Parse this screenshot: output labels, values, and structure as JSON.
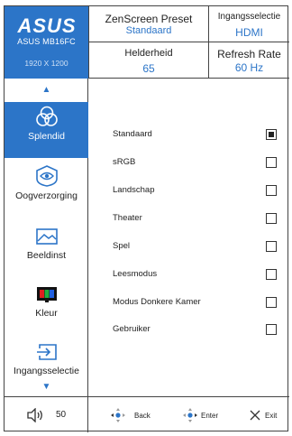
{
  "header": {
    "brand": "ASUS",
    "model": "ASUS MB16FC",
    "resolution": "1920 X 1200",
    "zenscreen_preset_label": "ZenScreen Preset",
    "zenscreen_preset_value": "Standaard",
    "input_label": "Ingangsselectie",
    "input_value": "HDMI",
    "brightness_label": "Helderheid",
    "brightness_value": "65",
    "refresh_label": "Refresh Rate",
    "refresh_value": "60 Hz"
  },
  "sidebar": {
    "items": [
      {
        "label": "Splendid",
        "icon": "splendid-icon",
        "active": true
      },
      {
        "label": "Oogverzorging",
        "icon": "eye-icon",
        "active": false
      },
      {
        "label": "Beeldinst",
        "icon": "image-icon",
        "active": false
      },
      {
        "label": "Kleur",
        "icon": "color-icon",
        "active": false
      },
      {
        "label": "Ingangsselectie",
        "icon": "input-icon",
        "active": false
      }
    ]
  },
  "options": [
    {
      "label": "Standaard",
      "selected": true
    },
    {
      "label": "sRGB",
      "selected": false
    },
    {
      "label": "Landschap",
      "selected": false
    },
    {
      "label": "Theater",
      "selected": false
    },
    {
      "label": "Spel",
      "selected": false
    },
    {
      "label": "Leesmodus",
      "selected": false
    },
    {
      "label": "Modus Donkere Kamer",
      "selected": false
    },
    {
      "label": "Gebruiker",
      "selected": false
    }
  ],
  "footer": {
    "volume": "50",
    "back_label": "Back",
    "enter_label": "Enter",
    "exit_label": "Exit"
  },
  "colors": {
    "accent": "#2c75c8",
    "border": "#444444"
  }
}
